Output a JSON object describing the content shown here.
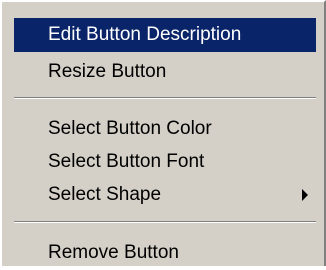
{
  "menu": {
    "items": [
      {
        "label": "Edit Button Description"
      },
      {
        "label": "Resize Button"
      },
      {
        "label": "Select Button Color"
      },
      {
        "label": "Select Button Font"
      },
      {
        "label": "Select Shape",
        "icon": "submenu-arrow-icon"
      },
      {
        "label": "Remove Button"
      }
    ],
    "colors": {
      "background": "#d4d0c8",
      "highlight": "#0a246a",
      "highlight_text": "#ffffff"
    }
  }
}
